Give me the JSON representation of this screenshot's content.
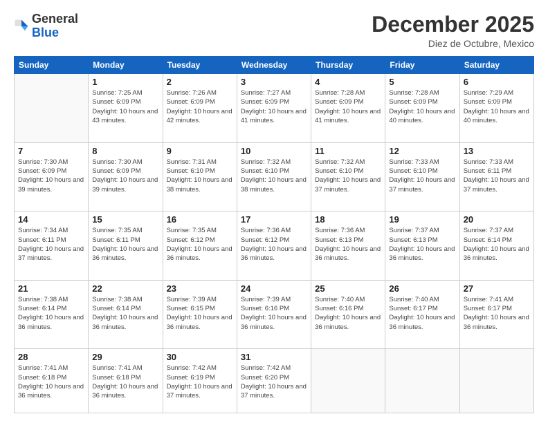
{
  "logo": {
    "general": "General",
    "blue": "Blue"
  },
  "header": {
    "month": "December 2025",
    "location": "Diez de Octubre, Mexico"
  },
  "days_header": [
    "Sunday",
    "Monday",
    "Tuesday",
    "Wednesday",
    "Thursday",
    "Friday",
    "Saturday"
  ],
  "weeks": [
    [
      {
        "day": "",
        "sunrise": "",
        "sunset": "",
        "daylight": ""
      },
      {
        "day": "1",
        "sunrise": "Sunrise: 7:25 AM",
        "sunset": "Sunset: 6:09 PM",
        "daylight": "Daylight: 10 hours and 43 minutes."
      },
      {
        "day": "2",
        "sunrise": "Sunrise: 7:26 AM",
        "sunset": "Sunset: 6:09 PM",
        "daylight": "Daylight: 10 hours and 42 minutes."
      },
      {
        "day": "3",
        "sunrise": "Sunrise: 7:27 AM",
        "sunset": "Sunset: 6:09 PM",
        "daylight": "Daylight: 10 hours and 41 minutes."
      },
      {
        "day": "4",
        "sunrise": "Sunrise: 7:28 AM",
        "sunset": "Sunset: 6:09 PM",
        "daylight": "Daylight: 10 hours and 41 minutes."
      },
      {
        "day": "5",
        "sunrise": "Sunrise: 7:28 AM",
        "sunset": "Sunset: 6:09 PM",
        "daylight": "Daylight: 10 hours and 40 minutes."
      },
      {
        "day": "6",
        "sunrise": "Sunrise: 7:29 AM",
        "sunset": "Sunset: 6:09 PM",
        "daylight": "Daylight: 10 hours and 40 minutes."
      }
    ],
    [
      {
        "day": "7",
        "sunrise": "Sunrise: 7:30 AM",
        "sunset": "Sunset: 6:09 PM",
        "daylight": "Daylight: 10 hours and 39 minutes."
      },
      {
        "day": "8",
        "sunrise": "Sunrise: 7:30 AM",
        "sunset": "Sunset: 6:09 PM",
        "daylight": "Daylight: 10 hours and 39 minutes."
      },
      {
        "day": "9",
        "sunrise": "Sunrise: 7:31 AM",
        "sunset": "Sunset: 6:10 PM",
        "daylight": "Daylight: 10 hours and 38 minutes."
      },
      {
        "day": "10",
        "sunrise": "Sunrise: 7:32 AM",
        "sunset": "Sunset: 6:10 PM",
        "daylight": "Daylight: 10 hours and 38 minutes."
      },
      {
        "day": "11",
        "sunrise": "Sunrise: 7:32 AM",
        "sunset": "Sunset: 6:10 PM",
        "daylight": "Daylight: 10 hours and 37 minutes."
      },
      {
        "day": "12",
        "sunrise": "Sunrise: 7:33 AM",
        "sunset": "Sunset: 6:10 PM",
        "daylight": "Daylight: 10 hours and 37 minutes."
      },
      {
        "day": "13",
        "sunrise": "Sunrise: 7:33 AM",
        "sunset": "Sunset: 6:11 PM",
        "daylight": "Daylight: 10 hours and 37 minutes."
      }
    ],
    [
      {
        "day": "14",
        "sunrise": "Sunrise: 7:34 AM",
        "sunset": "Sunset: 6:11 PM",
        "daylight": "Daylight: 10 hours and 37 minutes."
      },
      {
        "day": "15",
        "sunrise": "Sunrise: 7:35 AM",
        "sunset": "Sunset: 6:11 PM",
        "daylight": "Daylight: 10 hours and 36 minutes."
      },
      {
        "day": "16",
        "sunrise": "Sunrise: 7:35 AM",
        "sunset": "Sunset: 6:12 PM",
        "daylight": "Daylight: 10 hours and 36 minutes."
      },
      {
        "day": "17",
        "sunrise": "Sunrise: 7:36 AM",
        "sunset": "Sunset: 6:12 PM",
        "daylight": "Daylight: 10 hours and 36 minutes."
      },
      {
        "day": "18",
        "sunrise": "Sunrise: 7:36 AM",
        "sunset": "Sunset: 6:13 PM",
        "daylight": "Daylight: 10 hours and 36 minutes."
      },
      {
        "day": "19",
        "sunrise": "Sunrise: 7:37 AM",
        "sunset": "Sunset: 6:13 PM",
        "daylight": "Daylight: 10 hours and 36 minutes."
      },
      {
        "day": "20",
        "sunrise": "Sunrise: 7:37 AM",
        "sunset": "Sunset: 6:14 PM",
        "daylight": "Daylight: 10 hours and 36 minutes."
      }
    ],
    [
      {
        "day": "21",
        "sunrise": "Sunrise: 7:38 AM",
        "sunset": "Sunset: 6:14 PM",
        "daylight": "Daylight: 10 hours and 36 minutes."
      },
      {
        "day": "22",
        "sunrise": "Sunrise: 7:38 AM",
        "sunset": "Sunset: 6:14 PM",
        "daylight": "Daylight: 10 hours and 36 minutes."
      },
      {
        "day": "23",
        "sunrise": "Sunrise: 7:39 AM",
        "sunset": "Sunset: 6:15 PM",
        "daylight": "Daylight: 10 hours and 36 minutes."
      },
      {
        "day": "24",
        "sunrise": "Sunrise: 7:39 AM",
        "sunset": "Sunset: 6:16 PM",
        "daylight": "Daylight: 10 hours and 36 minutes."
      },
      {
        "day": "25",
        "sunrise": "Sunrise: 7:40 AM",
        "sunset": "Sunset: 6:16 PM",
        "daylight": "Daylight: 10 hours and 36 minutes."
      },
      {
        "day": "26",
        "sunrise": "Sunrise: 7:40 AM",
        "sunset": "Sunset: 6:17 PM",
        "daylight": "Daylight: 10 hours and 36 minutes."
      },
      {
        "day": "27",
        "sunrise": "Sunrise: 7:41 AM",
        "sunset": "Sunset: 6:17 PM",
        "daylight": "Daylight: 10 hours and 36 minutes."
      }
    ],
    [
      {
        "day": "28",
        "sunrise": "Sunrise: 7:41 AM",
        "sunset": "Sunset: 6:18 PM",
        "daylight": "Daylight: 10 hours and 36 minutes."
      },
      {
        "day": "29",
        "sunrise": "Sunrise: 7:41 AM",
        "sunset": "Sunset: 6:18 PM",
        "daylight": "Daylight: 10 hours and 36 minutes."
      },
      {
        "day": "30",
        "sunrise": "Sunrise: 7:42 AM",
        "sunset": "Sunset: 6:19 PM",
        "daylight": "Daylight: 10 hours and 37 minutes."
      },
      {
        "day": "31",
        "sunrise": "Sunrise: 7:42 AM",
        "sunset": "Sunset: 6:20 PM",
        "daylight": "Daylight: 10 hours and 37 minutes."
      },
      {
        "day": "",
        "sunrise": "",
        "sunset": "",
        "daylight": ""
      },
      {
        "day": "",
        "sunrise": "",
        "sunset": "",
        "daylight": ""
      },
      {
        "day": "",
        "sunrise": "",
        "sunset": "",
        "daylight": ""
      }
    ]
  ]
}
